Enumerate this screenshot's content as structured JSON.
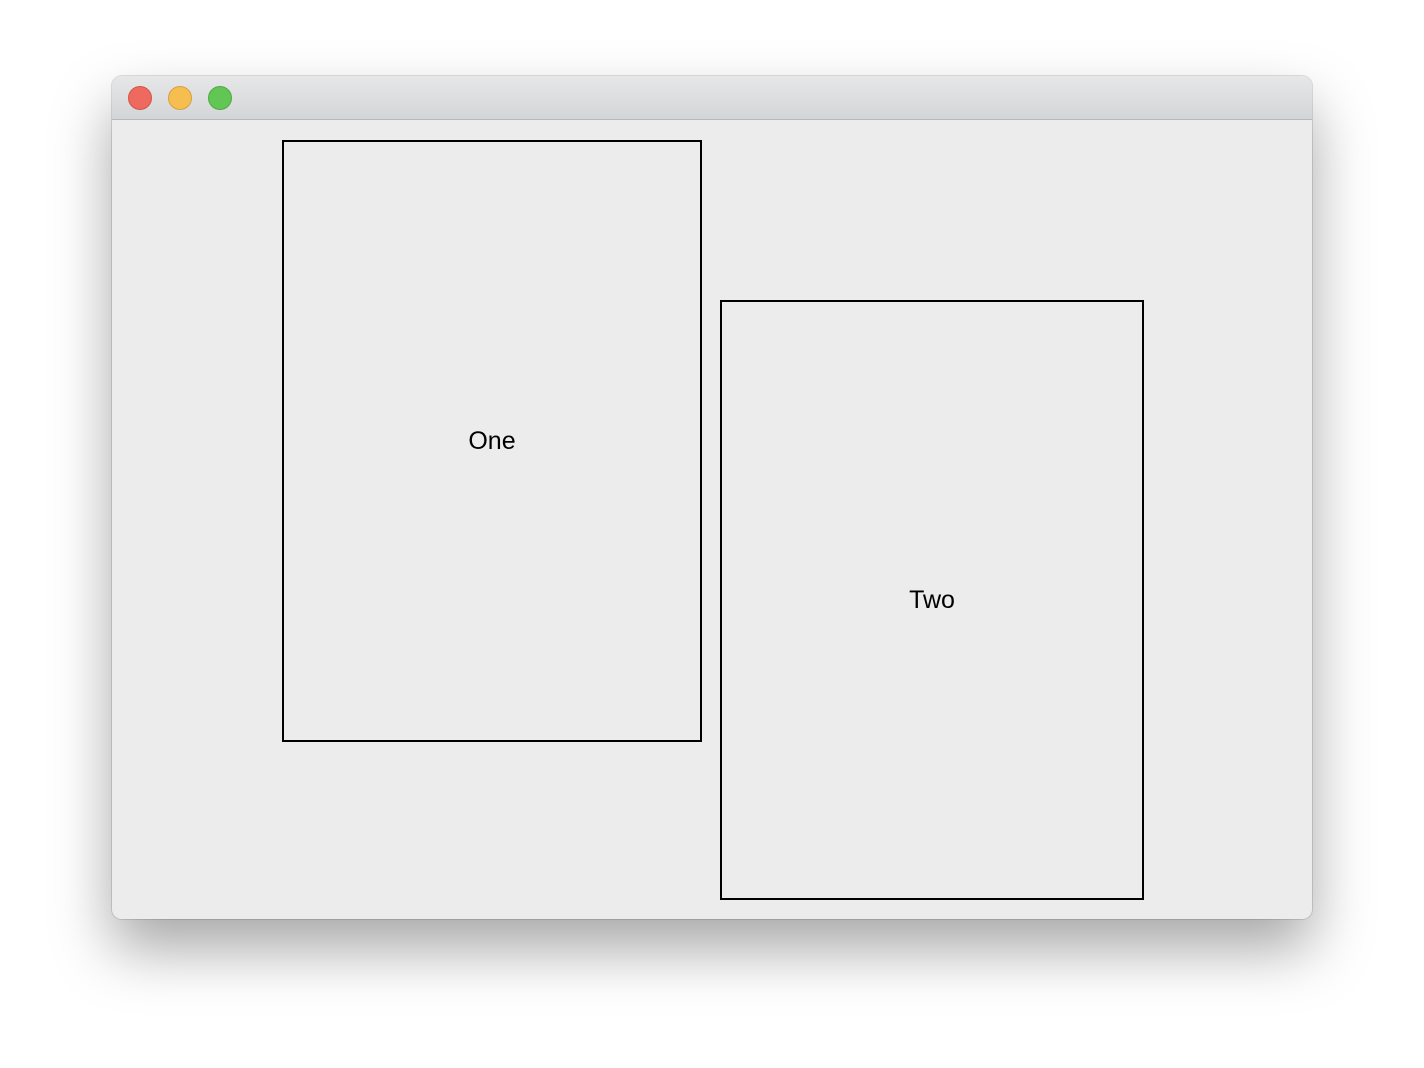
{
  "window": {
    "controls": {
      "close_icon": "close-icon",
      "minimize_icon": "minimize-icon",
      "zoom_icon": "zoom-icon",
      "close_color": "#ee6a5f",
      "minimize_color": "#f5be4f",
      "zoom_color": "#62c655"
    },
    "background_color": "#ececec"
  },
  "panels": [
    {
      "label": "One"
    },
    {
      "label": "Two"
    }
  ]
}
